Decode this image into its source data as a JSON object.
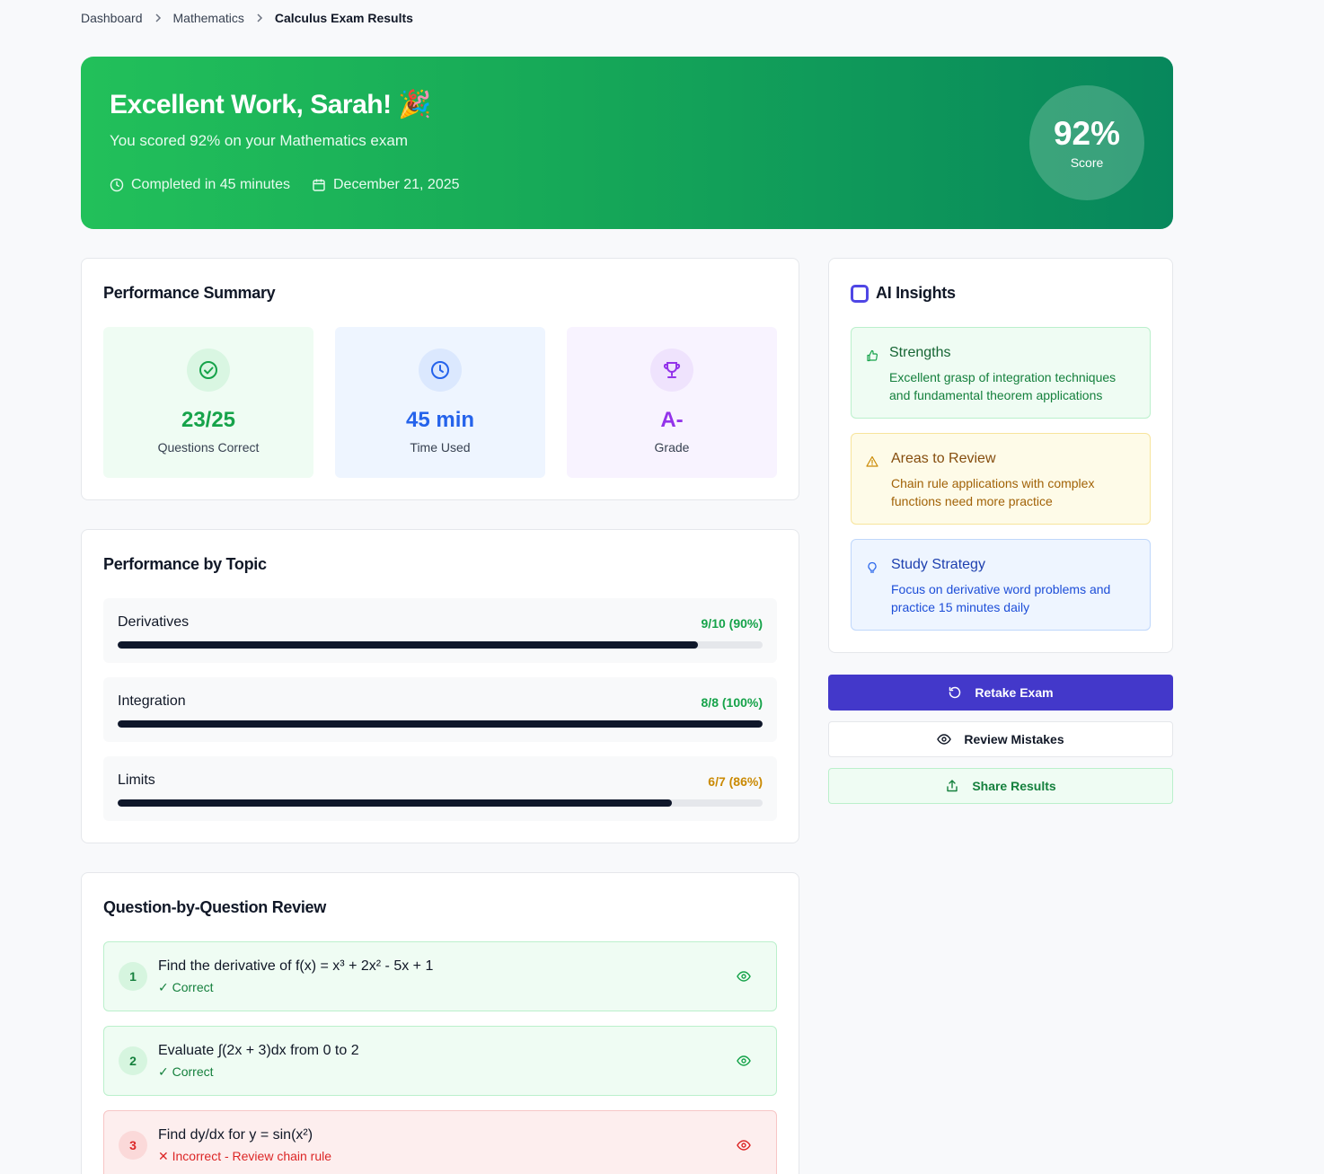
{
  "breadcrumb": {
    "items": [
      "Dashboard",
      "Mathematics"
    ],
    "current": "Calculus Exam Results"
  },
  "hero": {
    "title": "Excellent Work, Sarah! 🎉",
    "subtitle": "You scored 92% on your Mathematics exam",
    "duration": "Completed in 45 minutes",
    "date": "December 21, 2025",
    "score": "92%",
    "score_label": "Score"
  },
  "summary": {
    "title": "Performance Summary",
    "stats": [
      {
        "value": "23/25",
        "label": "Questions Correct",
        "icon": "check-circle-icon"
      },
      {
        "value": "45 min",
        "label": "Time Used",
        "icon": "clock-icon"
      },
      {
        "value": "A-",
        "label": "Grade",
        "icon": "trophy-icon"
      }
    ]
  },
  "topics": {
    "title": "Performance by Topic",
    "items": [
      {
        "name": "Derivatives",
        "score": "9/10 (90%)",
        "percent": 90,
        "color": "#16a34a"
      },
      {
        "name": "Integration",
        "score": "8/8 (100%)",
        "percent": 100,
        "color": "#16a34a"
      },
      {
        "name": "Limits",
        "score": "6/7 (86%)",
        "percent": 86,
        "color": "#ca8a04"
      }
    ]
  },
  "review": {
    "title": "Question-by-Question Review",
    "questions": [
      {
        "num": "1",
        "text": "Find the derivative of f(x) = x³ + 2x² - 5x + 1",
        "status": "✓ Correct",
        "correct": true
      },
      {
        "num": "2",
        "text": "Evaluate ∫(2x + 3)dx from 0 to 2",
        "status": "✓ Correct",
        "correct": true
      },
      {
        "num": "3",
        "text": "Find dy/dx for y = sin(x²)",
        "status": "✕ Incorrect - Review chain rule",
        "correct": false
      }
    ]
  },
  "ai": {
    "title": "AI Insights",
    "insights": [
      {
        "title": "Strengths",
        "text": "Excellent grasp of integration techniques and fundamental theorem applications",
        "icon": "thumbs-up-icon"
      },
      {
        "title": "Areas to Review",
        "text": "Chain rule applications with complex functions need more practice",
        "icon": "warning-icon"
      },
      {
        "title": "Study Strategy",
        "text": "Focus on derivative word problems and practice 15 minutes daily",
        "icon": "lightbulb-icon"
      }
    ]
  },
  "actions": {
    "retake": "Retake Exam",
    "review": "Review Mistakes",
    "share": "Share Results"
  },
  "colors": {
    "accent": "#4338ca",
    "success": "#16a34a",
    "warning": "#ca8a04",
    "error": "#dc2626"
  }
}
